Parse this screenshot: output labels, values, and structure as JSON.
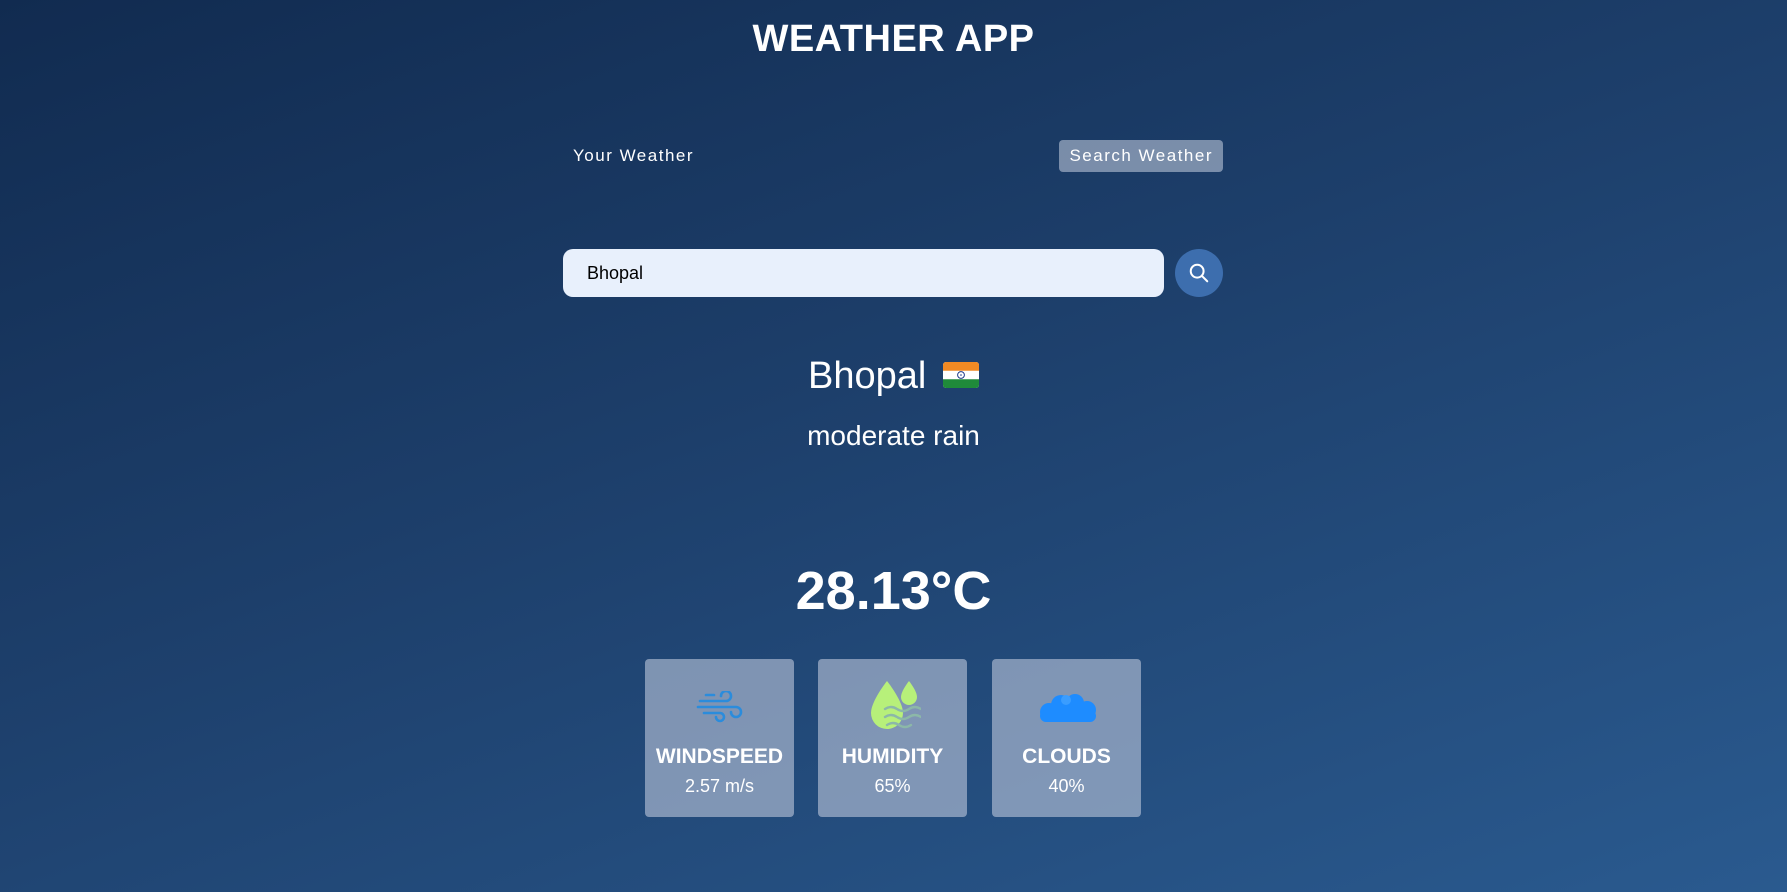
{
  "app": {
    "title": "WEATHER APP"
  },
  "tabs": [
    {
      "label": "Your Weather",
      "active": false
    },
    {
      "label": "Search Weather",
      "active": true
    }
  ],
  "search": {
    "value": "Bhopal",
    "button_icon": "search-icon"
  },
  "weather": {
    "city": "Bhopal",
    "country_flag_icon": "india-flag-icon",
    "description": "moderate rain",
    "temperature": "28.13°C"
  },
  "stats": [
    {
      "label": "WINDSPEED",
      "value": "2.57 m/s",
      "icon": "wind-icon"
    },
    {
      "label": "HUMIDITY",
      "value": "65%",
      "icon": "humidity-icon"
    },
    {
      "label": "CLOUDS",
      "value": "40%",
      "icon": "cloud-icon"
    }
  ],
  "colors": {
    "background_start": "#112b50",
    "background_end": "#2a5a8f",
    "search_button": "#3d6eae",
    "input_background": "#e8f0fc",
    "wind_icon": "#2b8cdc",
    "humidity_icon": "#b7f07a",
    "cloud_icon": "#1e8cff"
  }
}
